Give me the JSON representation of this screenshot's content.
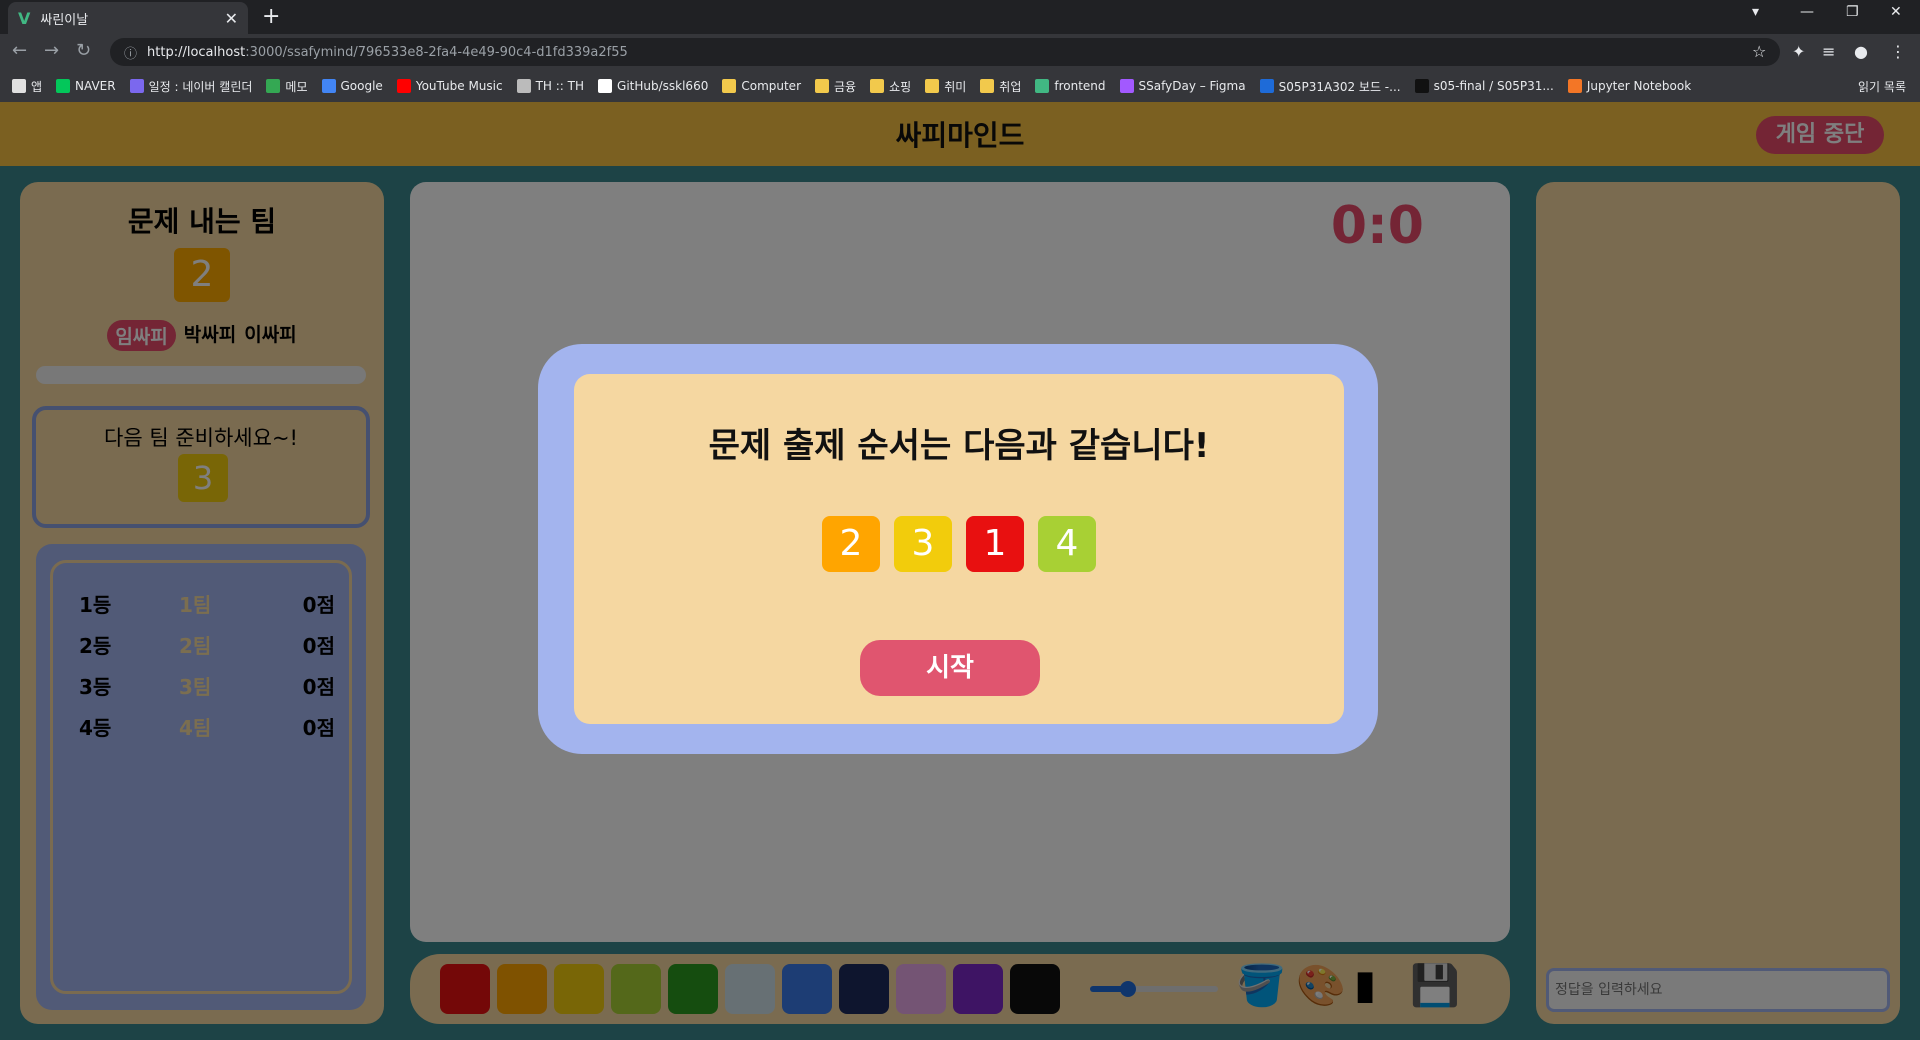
{
  "browser": {
    "tab_title": "싸린이날",
    "url_host": "http://localhost",
    "url_path": ":3000/ssafymind/796533e8-2fa4-4e49-90c4-d1fd339a2f55",
    "bookmarks": [
      "앱",
      "NAVER",
      "일정 : 네이버 캘린더",
      "메모",
      "Google",
      "YouTube Music",
      "TH :: TH",
      "GitHub/sskl660",
      "Computer",
      "금융",
      "쇼핑",
      "취미",
      "취업",
      "frontend",
      "SSafyDay – Figma",
      "S05P31A302 보드 -...",
      "s05-final / S05P31...",
      "Jupyter Notebook"
    ],
    "reading_list": "읽기 목록"
  },
  "header": {
    "title": "싸피마인드",
    "stop_button": "게임 중단"
  },
  "left": {
    "title": "문제 내는 팀",
    "current_team": "2",
    "members": [
      "임싸피",
      "박싸피",
      "이싸피"
    ],
    "next_label": "다음 팀 준비하세요~!",
    "next_team": "3",
    "ranking": [
      {
        "rank": "1등",
        "team": "1팀",
        "score": "0점"
      },
      {
        "rank": "2등",
        "team": "2팀",
        "score": "0점"
      },
      {
        "rank": "3등",
        "team": "3팀",
        "score": "0점"
      },
      {
        "rank": "4등",
        "team": "4팀",
        "score": "0점"
      }
    ]
  },
  "center": {
    "score": "0:0"
  },
  "right": {
    "answer_placeholder": "정답을 입력하세요"
  },
  "modal": {
    "title": "문제 출제 순서는 다음과 같습니다!",
    "order": [
      "2",
      "3",
      "1",
      "4"
    ],
    "order_colors": [
      "#ffa500",
      "#f2cc0c",
      "#e81010",
      "#a8d034"
    ],
    "start_button": "시작"
  },
  "palette": [
    "#e81010",
    "#ffa500",
    "#f2cc0c",
    "#a8d034",
    "#2a9a1f",
    "#cfe0e8",
    "#3a7ae8",
    "#1c2a5c",
    "#e8a8e8",
    "#7c28c8",
    "#111111"
  ]
}
